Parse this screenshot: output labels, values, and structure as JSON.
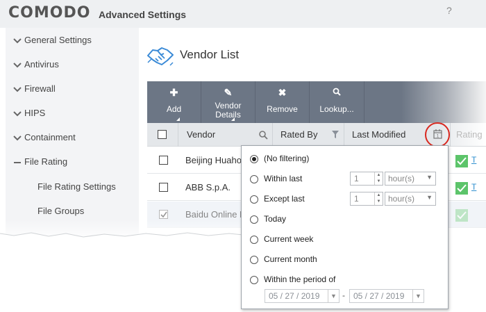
{
  "header": {
    "logo": "COMODO",
    "title": "Advanced Settings",
    "help": "?"
  },
  "sidebar": {
    "items": [
      {
        "label": "General Settings",
        "state": "collapsed"
      },
      {
        "label": "Antivirus",
        "state": "collapsed"
      },
      {
        "label": "Firewall",
        "state": "collapsed"
      },
      {
        "label": "HIPS",
        "state": "collapsed"
      },
      {
        "label": "Containment",
        "state": "collapsed"
      },
      {
        "label": "File Rating",
        "state": "expanded"
      }
    ],
    "subitems": [
      {
        "label": "File Rating Settings"
      },
      {
        "label": "File Groups"
      }
    ]
  },
  "main": {
    "title": "Vendor List",
    "title_icon": "handshake-icon"
  },
  "toolbar": {
    "add": "Add",
    "vendor_details_line1": "Vendor",
    "vendor_details_line2": "Details",
    "remove": "Remove",
    "lookup": "Lookup..."
  },
  "table": {
    "columns": {
      "vendor": "Vendor",
      "rated_by": "Rated By",
      "last_modified": "Last Modified",
      "rating": "Rating"
    },
    "rows": [
      {
        "vendor": "Beijing Huahong",
        "checked": false,
        "rating_link": "T"
      },
      {
        "vendor": "ABB S.p.A.",
        "checked": false,
        "rating_link": "T"
      },
      {
        "vendor": "Baidu Online N",
        "checked": true,
        "rating_link": ""
      }
    ]
  },
  "filter": {
    "options": [
      {
        "label": "(No filtering)",
        "selected": true
      },
      {
        "label": "Within last",
        "selected": false
      },
      {
        "label": "Except last",
        "selected": false
      },
      {
        "label": "Today",
        "selected": false
      },
      {
        "label": "Current week",
        "selected": false
      },
      {
        "label": "Current month",
        "selected": false
      },
      {
        "label": "Within the period of",
        "selected": false
      }
    ],
    "within_last": {
      "value": "1",
      "unit": "hour(s)"
    },
    "except_last": {
      "value": "1",
      "unit": "hour(s)"
    },
    "period": {
      "from": "05 / 27 / 2019",
      "separator": "-",
      "to": "05 / 27 / 2019"
    }
  },
  "colors": {
    "toolbar": "#6c7685",
    "accent_red": "#d9281f",
    "rating_green": "#5cc46a",
    "icon_blue": "#3a8ad6"
  }
}
